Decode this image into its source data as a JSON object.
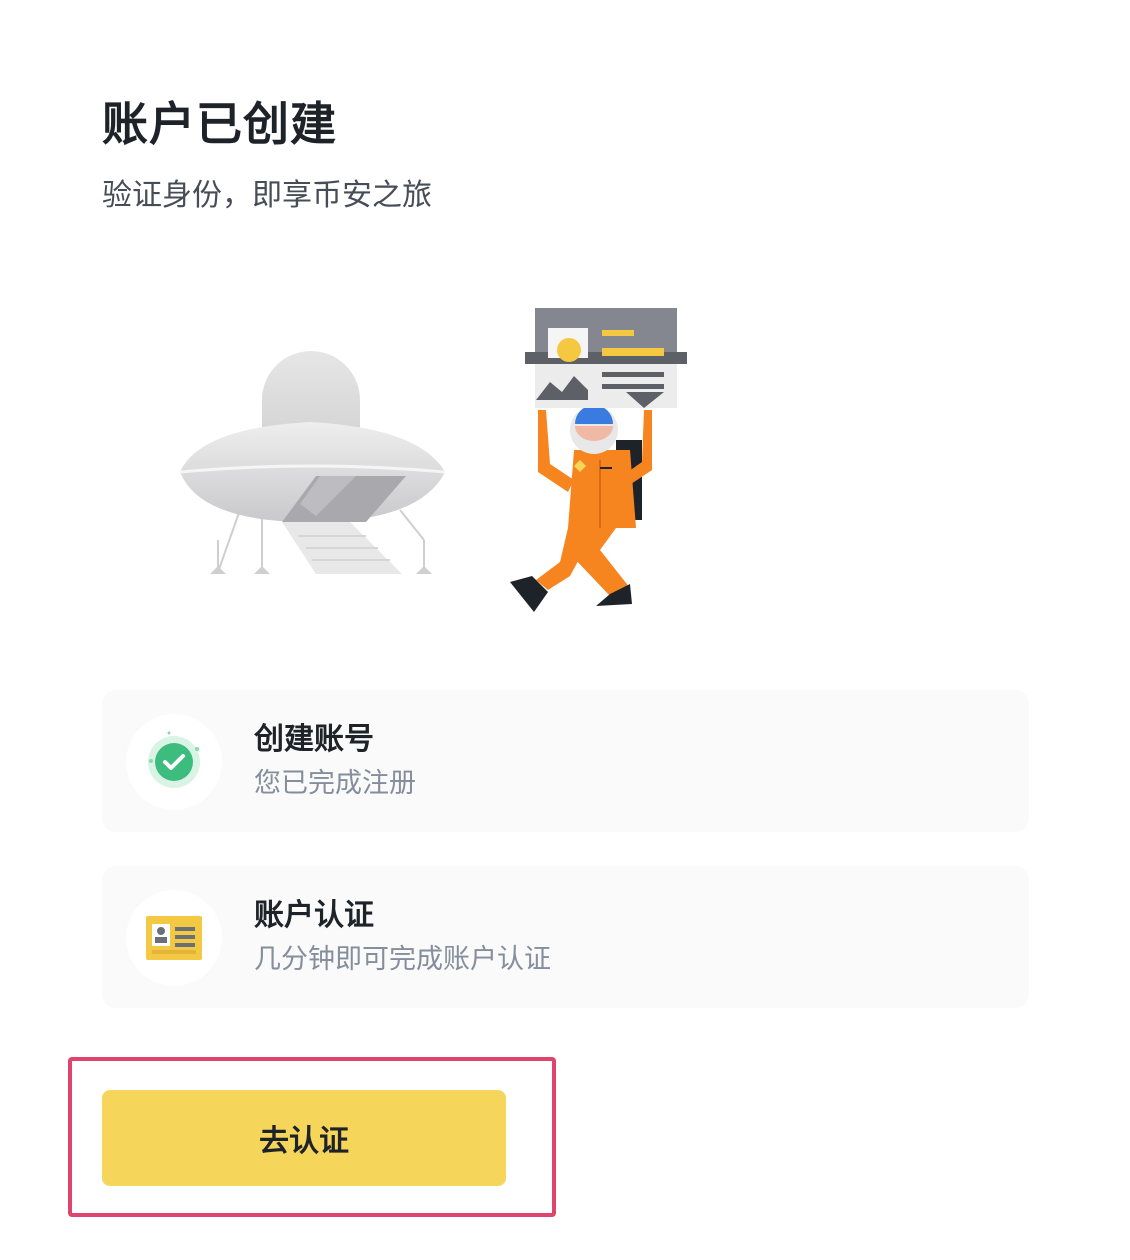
{
  "header": {
    "title": "账户已创建",
    "subtitle": "验证身份，即享币安之旅"
  },
  "illustration": {
    "icon": "ufo-astronaut-id-card-illustration"
  },
  "steps": [
    {
      "title": "创建账号",
      "description": "您已完成注册",
      "icon": "check-circle-icon",
      "status": "completed"
    },
    {
      "title": "账户认证",
      "description": "几分钟即可完成账户认证",
      "icon": "id-card-icon",
      "status": "pending"
    }
  ],
  "action": {
    "verify_label": "去认证"
  },
  "colors": {
    "accent": "#f5d65a",
    "success": "#3dbd7d",
    "highlight": "#e0436c",
    "card_bg": "#fafafa"
  }
}
